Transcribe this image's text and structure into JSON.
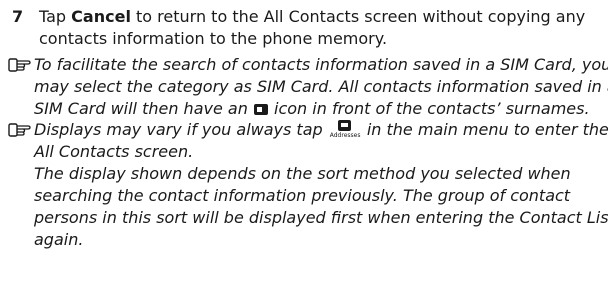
{
  "step": {
    "number": "7",
    "lines": [
      {
        "pre": "Tap ",
        "bold": "Cancel",
        "post": " to return to the All Contacts screen without copying any"
      },
      {
        "pre": "contacts information to the phone memory.",
        "bold": "",
        "post": ""
      }
    ]
  },
  "note1": {
    "icon": "pointing-hand-icon",
    "lines": [
      "To facilitate the search of contacts information saved in a SIM Card, you",
      "may select the category as SIM Card. All contacts information saved in a"
    ],
    "line3_pre": "SIM Card will then have an ",
    "line3_icon": "sim-card-icon",
    "line3_post": " icon in front of the contacts’ surnames."
  },
  "note2": {
    "icon": "pointing-hand-icon",
    "line1_pre": "Displays may vary if you always tap ",
    "line1_icon": "addresses-icon",
    "line1_icon_label": "Addresses",
    "line1_post": " in the main menu to enter the",
    "lines": [
      "All Contacts screen.",
      "The display shown depends on the sort method you selected when",
      "searching the contact information previously. The group of contact",
      "persons in this sort will be displayed first when entering the Contact List",
      "again."
    ]
  }
}
